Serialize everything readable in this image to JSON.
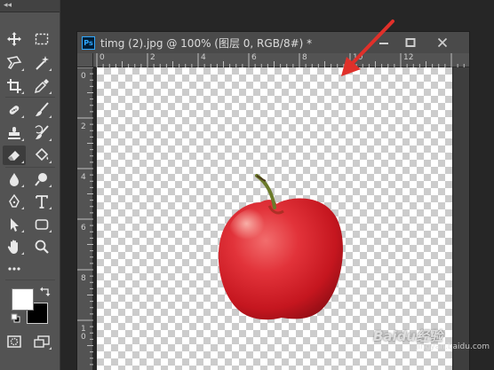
{
  "document": {
    "app_badge": "Ps",
    "title": "timg (2).jpg @ 100% (图层 0, RGB/8#) *"
  },
  "rulers": {
    "horizontal_labels": [
      "0",
      "2",
      "4",
      "6",
      "8",
      "10",
      "12"
    ],
    "vertical_labels": [
      "0",
      "2",
      "4",
      "6",
      "8",
      "1\n0"
    ]
  },
  "tools": [
    {
      "id": "move",
      "icon": "move-icon"
    },
    {
      "id": "marquee",
      "icon": "rect-marquee-icon"
    },
    {
      "id": "lasso",
      "icon": "lasso-icon"
    },
    {
      "id": "magic",
      "icon": "magic-wand-icon"
    },
    {
      "id": "crop",
      "icon": "crop-icon"
    },
    {
      "id": "eyedropper",
      "icon": "eyedropper-icon"
    },
    {
      "id": "healing",
      "icon": "healing-brush-icon"
    },
    {
      "id": "brush",
      "icon": "brush-icon"
    },
    {
      "id": "stamp",
      "icon": "clone-stamp-icon"
    },
    {
      "id": "history",
      "icon": "history-brush-icon"
    },
    {
      "id": "eraser",
      "icon": "eraser-icon"
    },
    {
      "id": "bucket",
      "icon": "paint-bucket-icon"
    },
    {
      "id": "blur",
      "icon": "blur-icon"
    },
    {
      "id": "dodge",
      "icon": "dodge-icon"
    },
    {
      "id": "pen",
      "icon": "pen-icon"
    },
    {
      "id": "type",
      "icon": "type-icon",
      "label": "T"
    },
    {
      "id": "select",
      "icon": "path-select-icon"
    },
    {
      "id": "shape",
      "icon": "rounded-rect-icon"
    },
    {
      "id": "hand",
      "icon": "hand-icon"
    },
    {
      "id": "zoom",
      "icon": "zoom-icon"
    },
    {
      "id": "more",
      "icon": "more-icon",
      "label": "•••"
    }
  ],
  "colors": {
    "foreground": "#ffffff",
    "background": "#000000",
    "annotation_arrow": "#e0302a"
  },
  "watermark": {
    "text": "Baidu经验",
    "sub": "jingyan.baidu.com"
  }
}
